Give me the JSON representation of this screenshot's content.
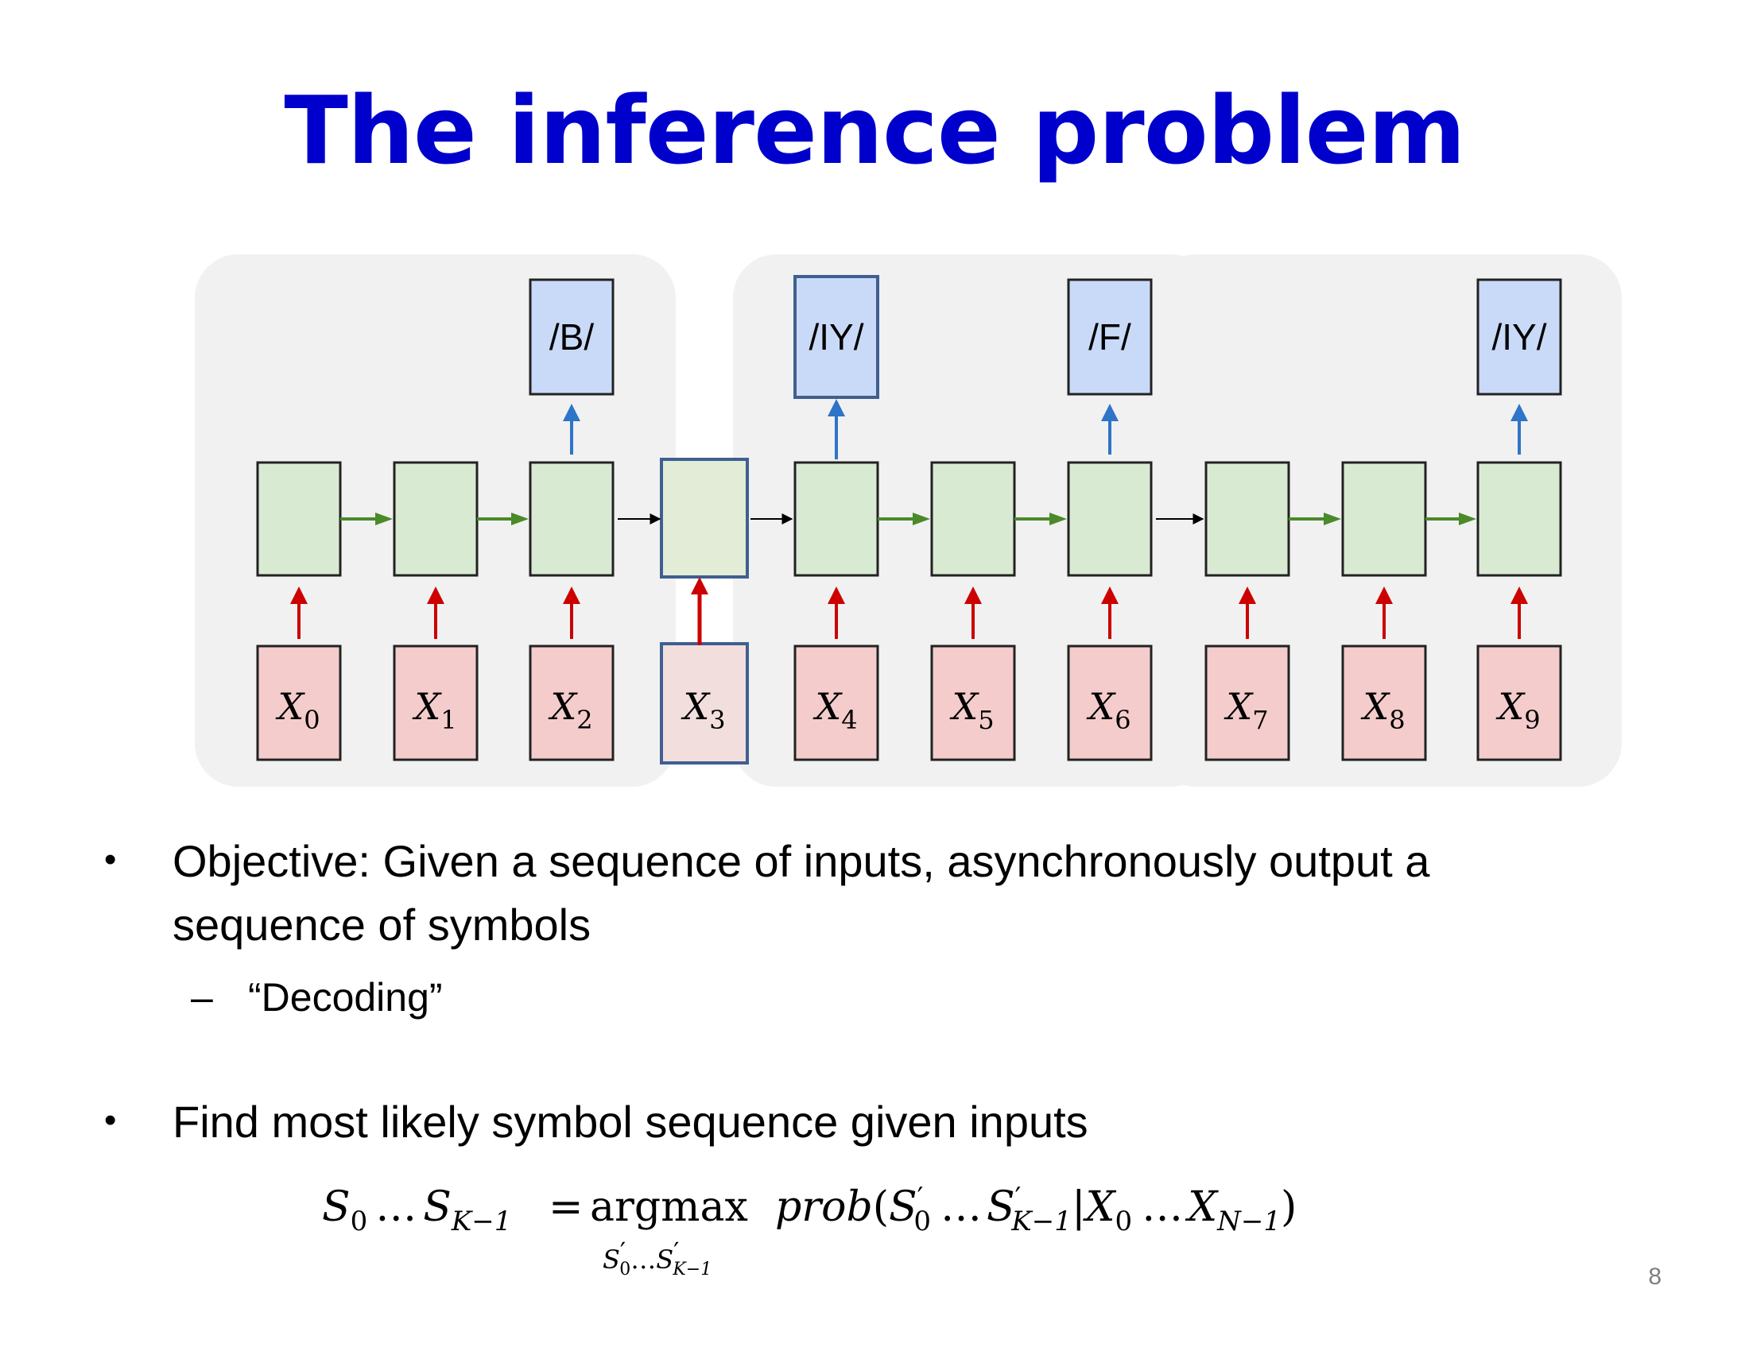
{
  "slide": {
    "title": "The inference problem",
    "page_number": "8"
  },
  "diagram": {
    "outputs": [
      "/B/",
      "/IY/",
      "/F/",
      "/IY/"
    ],
    "inputs": [
      {
        "name": "X",
        "sub": "0"
      },
      {
        "name": "X",
        "sub": "1"
      },
      {
        "name": "X",
        "sub": "2"
      },
      {
        "name": "X",
        "sub": "3"
      },
      {
        "name": "X",
        "sub": "4"
      },
      {
        "name": "X",
        "sub": "5"
      },
      {
        "name": "X",
        "sub": "6"
      },
      {
        "name": "X",
        "sub": "7"
      },
      {
        "name": "X",
        "sub": "8"
      },
      {
        "name": "X",
        "sub": "9"
      }
    ],
    "colors": {
      "input_fill": "#f4cccc",
      "hidden_fill": "#d9ead3",
      "output_fill": "#c9daf8",
      "highlight_border": "#3f5f8f",
      "group_bg": "#f1f1f1",
      "red_arrow": "#cc0000",
      "green_arrow": "#4a8a2a",
      "blue_arrow": "#2e74c8"
    }
  },
  "bullets": [
    {
      "text_line1": "Objective: Given a sequence of inputs, asynchronously output a",
      "text_line2": "sequence of symbols",
      "sub": "“Decoding”"
    },
    {
      "text": "Find most likely symbol sequence given inputs"
    }
  ],
  "equation": {
    "lhs_s": "S",
    "lhs_s0": "0",
    "dots": "…",
    "lhs_sk": "K−1",
    "eq": "=",
    "argmax": "argmax",
    "under_s": "S",
    "under_0": "0",
    "under_k": "K−1",
    "prob": "prob",
    "prime": "′",
    "x": "X",
    "x0": "0",
    "xn": "N−1"
  }
}
